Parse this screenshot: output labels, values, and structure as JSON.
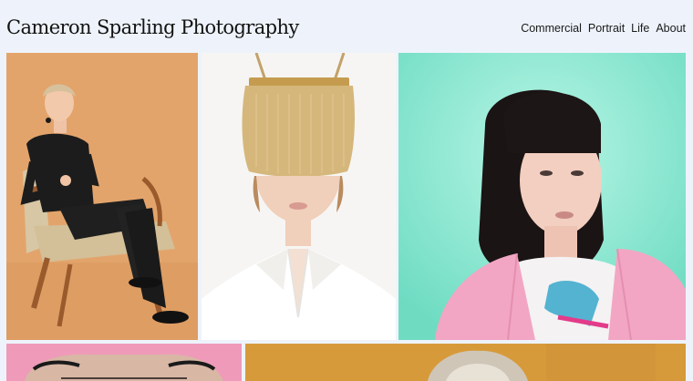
{
  "site": {
    "title": "Cameron Sparling Photography"
  },
  "nav": {
    "items": [
      {
        "label": "Commercial"
      },
      {
        "label": "Portrait"
      },
      {
        "label": "Life"
      },
      {
        "label": "About"
      }
    ]
  },
  "gallery": {
    "colors": {
      "tile1_bg": "#e3a46b",
      "tile2_bg": "#f6f5f3",
      "tile3_bg": "#7fe3cc",
      "tile4_bg": "#ef9ab9",
      "tile5_bg": "#d79a3a"
    }
  }
}
